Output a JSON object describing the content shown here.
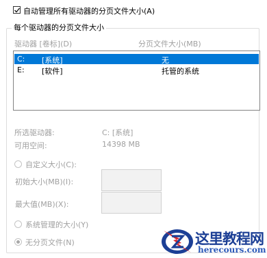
{
  "auto_manage": {
    "label": "自动管理所有驱动器的分页文件大小(A)",
    "checked": true
  },
  "group": {
    "title": "每个驱动器的分页文件大小",
    "columns": {
      "drive": "驱动器 [卷标](D)",
      "size": "分页文件大小(MB)"
    },
    "drives": [
      {
        "letter": "C:",
        "label": "[系统]",
        "size": "无",
        "selected": true
      },
      {
        "letter": "E:",
        "label": "[软件]",
        "size": "托管的系统",
        "selected": false
      }
    ],
    "selected_drive": {
      "label": "所选驱动器:",
      "value": "C:  [系统]"
    },
    "free_space": {
      "label": "可用空间:",
      "value": "14398 MB"
    },
    "custom_size": {
      "label": "自定义大小(C):"
    },
    "initial_size": {
      "label": "初始大小(MB)(I):",
      "value": ""
    },
    "max_size": {
      "label": "最大值(MB)(X):",
      "value": ""
    },
    "system_managed": {
      "label": "系统管理的大小(Y)"
    },
    "no_paging": {
      "label": "无分页文件(N)"
    }
  },
  "watermark": {
    "name": "这里教程网",
    "url": "herecours.com",
    "colors": {
      "red": "#d6262b",
      "blue": "#1c3f95",
      "url": "#2a58b8"
    }
  }
}
